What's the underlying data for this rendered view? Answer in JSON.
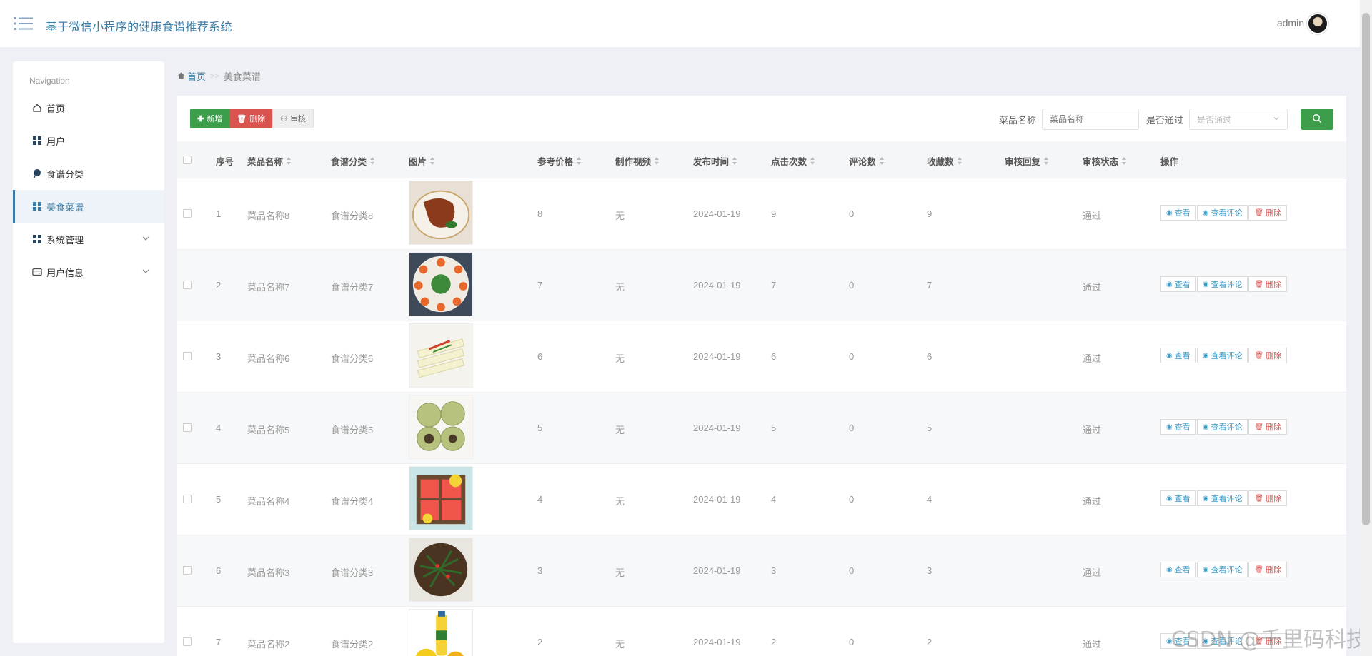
{
  "header": {
    "title": "基于微信小程序的健康食谱推荐系统",
    "user": "admin"
  },
  "sidebar": {
    "caption": "Navigation",
    "items": [
      {
        "label": "首页",
        "icon": "home-icon"
      },
      {
        "label": "用户",
        "icon": "grid-icon"
      },
      {
        "label": "食谱分类",
        "icon": "pin-icon"
      },
      {
        "label": "美食菜谱",
        "icon": "grid-icon",
        "active": true
      },
      {
        "label": "系统管理",
        "icon": "grid-icon"
      },
      {
        "label": "用户信息",
        "icon": "card-icon"
      }
    ]
  },
  "breadcrumb": {
    "home": "首页",
    "sep": ">>",
    "current": "美食菜谱"
  },
  "toolbar": {
    "add": "新增",
    "delete": "删除",
    "audit": "审核"
  },
  "search": {
    "name_label": "菜品名称",
    "name_placeholder": "菜品名称",
    "pass_label": "是否通过",
    "pass_placeholder": "是否通过"
  },
  "table": {
    "headers": [
      "序号",
      "菜品名称",
      "食谱分类",
      "图片",
      "参考价格",
      "制作视频",
      "发布时间",
      "点击次数",
      "评论数",
      "收藏数",
      "审核回复",
      "审核状态",
      "操作"
    ],
    "ops": {
      "view": "查看",
      "comment": "查看评论",
      "delete": "删除"
    },
    "rows": [
      {
        "no": "1",
        "name": "菜品名称8",
        "category": "食谱分类8",
        "price": "8",
        "video": "无",
        "date": "2024-01-19",
        "clicks": "9",
        "comments": "0",
        "favs": "9",
        "reply": "",
        "status": "通过",
        "img": "duck"
      },
      {
        "no": "2",
        "name": "菜品名称7",
        "category": "食谱分类7",
        "price": "7",
        "video": "无",
        "date": "2024-01-19",
        "clicks": "7",
        "comments": "0",
        "favs": "7",
        "reply": "",
        "status": "通过",
        "img": "shrimp"
      },
      {
        "no": "3",
        "name": "菜品名称6",
        "category": "食谱分类6",
        "price": "6",
        "video": "无",
        "date": "2024-01-19",
        "clicks": "6",
        "comments": "0",
        "favs": "6",
        "reply": "",
        "status": "通过",
        "img": "bamboo"
      },
      {
        "no": "4",
        "name": "菜品名称5",
        "category": "食谱分类5",
        "price": "5",
        "video": "无",
        "date": "2024-01-19",
        "clicks": "5",
        "comments": "0",
        "favs": "5",
        "reply": "",
        "status": "通过",
        "img": "dumpling"
      },
      {
        "no": "5",
        "name": "菜品名称4",
        "category": "食谱分类4",
        "price": "4",
        "video": "无",
        "date": "2024-01-19",
        "clicks": "4",
        "comments": "0",
        "favs": "4",
        "reply": "",
        "status": "通过",
        "img": "watermelon"
      },
      {
        "no": "6",
        "name": "菜品名称3",
        "category": "食谱分类3",
        "price": "3",
        "video": "无",
        "date": "2024-01-19",
        "clicks": "3",
        "comments": "0",
        "favs": "3",
        "reply": "",
        "status": "通过",
        "img": "greens"
      },
      {
        "no": "7",
        "name": "菜品名称2",
        "category": "食谱分类2",
        "price": "2",
        "video": "无",
        "date": "2024-01-19",
        "clicks": "2",
        "comments": "0",
        "favs": "2",
        "reply": "",
        "status": "通过",
        "img": "juice"
      }
    ]
  },
  "watermark": "CSDN @千里码科技",
  "colors": {
    "accent": "#3a7ca5",
    "success": "#3c9d4a",
    "danger": "#d9534f"
  }
}
